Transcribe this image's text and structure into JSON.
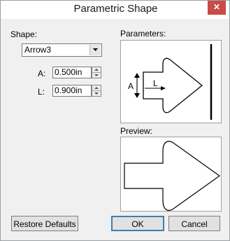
{
  "window": {
    "title": "Parametric Shape",
    "close_glyph": "✕"
  },
  "shape": {
    "label": "Shape:",
    "value": "Arrow3"
  },
  "params": [
    {
      "label": "A:",
      "value": "0.500in"
    },
    {
      "label": "L:",
      "value": "0.900in"
    }
  ],
  "parameters_panel": {
    "label": "Parameters:",
    "dim_a": "A",
    "dim_l": "L"
  },
  "preview_panel": {
    "label": "Preview:"
  },
  "buttons": {
    "restore": "Restore Defaults",
    "ok": "OK",
    "cancel": "Cancel"
  }
}
